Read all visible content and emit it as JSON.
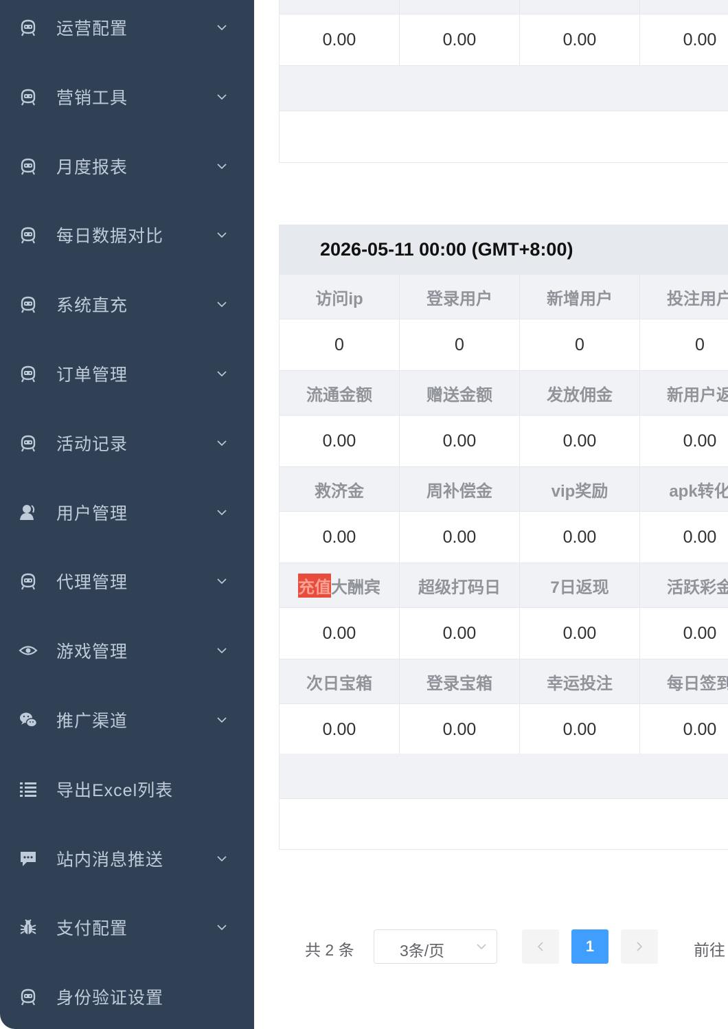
{
  "sidebar": {
    "items": [
      {
        "label": "运营配置",
        "icon": "robot-icon",
        "has_children": true
      },
      {
        "label": "营销工具",
        "icon": "robot-icon",
        "has_children": true
      },
      {
        "label": "月度报表",
        "icon": "robot-icon",
        "has_children": true
      },
      {
        "label": "每日数据对比",
        "icon": "robot-icon",
        "has_children": true
      },
      {
        "label": "系统直充",
        "icon": "robot-icon",
        "has_children": true
      },
      {
        "label": "订单管理",
        "icon": "robot-icon",
        "has_children": true
      },
      {
        "label": "活动记录",
        "icon": "robot-icon",
        "has_children": true
      },
      {
        "label": "用户管理",
        "icon": "user-icon",
        "has_children": true
      },
      {
        "label": "代理管理",
        "icon": "robot-icon",
        "has_children": true
      },
      {
        "label": "游戏管理",
        "icon": "eye-icon",
        "has_children": true
      },
      {
        "label": "推广渠道",
        "icon": "wechat-icon",
        "has_children": true
      },
      {
        "label": "导出Excel列表",
        "icon": "list-icon",
        "has_children": false
      },
      {
        "label": "站内消息推送",
        "icon": "message-icon",
        "has_children": true
      },
      {
        "label": "支付配置",
        "icon": "bug-icon",
        "has_children": true
      },
      {
        "label": "身份验证设置",
        "icon": "robot-icon",
        "has_children": false
      }
    ]
  },
  "block1": {
    "values": [
      "0.00",
      "0.00",
      "0.00",
      "0.00"
    ]
  },
  "block2": {
    "date": "2026-05-11 00:00 (GMT+8:00)",
    "rows": [
      {
        "headers": [
          "访问ip",
          "登录用户",
          "新增用户",
          "投注用户"
        ],
        "values": [
          "0",
          "0",
          "0",
          "0"
        ]
      },
      {
        "headers": [
          "流通金额",
          "赠送金额",
          "发放佣金",
          "新用户返"
        ],
        "values": [
          "0.00",
          "0.00",
          "0.00",
          "0.00"
        ]
      },
      {
        "headers": [
          "救济金",
          "周补偿金",
          "vip奖励",
          "apk转化"
        ],
        "values": [
          "0.00",
          "0.00",
          "0.00",
          "0.00"
        ]
      },
      {
        "headers": [
          "充值大酬宾",
          "超级打码日",
          "7日返现",
          "活跃彩金"
        ],
        "values": [
          "0.00",
          "0.00",
          "0.00",
          "0.00"
        ],
        "highlight": "充值",
        "highlight_rest": "大酬宾"
      },
      {
        "headers": [
          "次日宝箱",
          "登录宝箱",
          "幸运投注",
          "每日签到"
        ],
        "values": [
          "0.00",
          "0.00",
          "0.00",
          "0.00"
        ]
      }
    ]
  },
  "pagination": {
    "total": "共 2 条",
    "page_size": "3条/页",
    "current_page": "1",
    "goto": "前往"
  },
  "colors": {
    "sidebar_bg": "#304156",
    "sidebar_text": "#bfcbd9",
    "accent": "#409eff",
    "highlight": "#e74c3c"
  }
}
